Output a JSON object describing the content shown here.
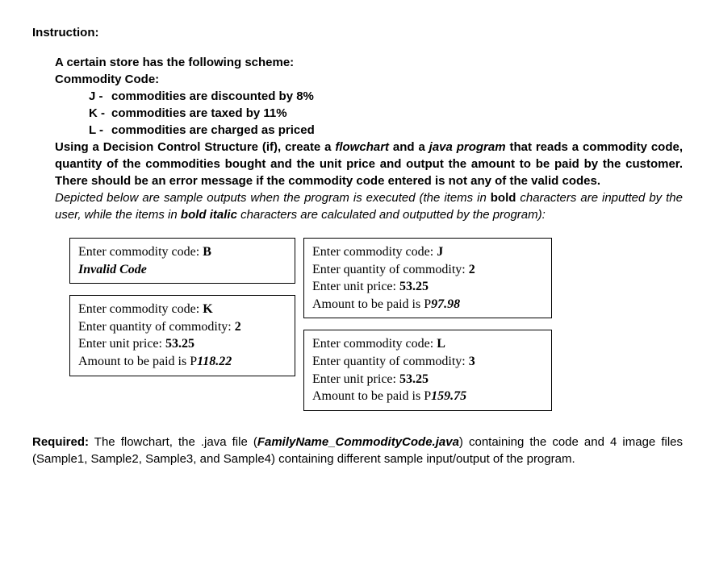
{
  "heading": "Instruction:",
  "scheme": {
    "intro1": "A certain store has the following scheme:",
    "intro2": "Commodity Code:",
    "codes": [
      {
        "letter": "J - ",
        "desc": "commodities are discounted by 8%"
      },
      {
        "letter": "K - ",
        "desc": "commodities are taxed by 11%"
      },
      {
        "letter": "L - ",
        "desc": "commodities are charged as priced"
      }
    ]
  },
  "problem": {
    "part1": "Using a Decision Control Structure (if), create a ",
    "flowchart_word": "flowchart",
    "part2": " and a ",
    "java_word": "java program",
    "part3": " that reads a commodity code, quantity of the commodities bought and the unit price and output the amount to be paid by the customer. There should be an error message if the commodity code entered is not any of the valid codes."
  },
  "depicted": {
    "part1": "Depicted below are sample outputs when the program is executed (the items in ",
    "bold_word": "bold",
    "part2": " characters are inputted by the user, while the items in ",
    "bold_italic_word": "bold italic",
    "part3": " characters are calculated and outputted by the program):"
  },
  "samples": {
    "s1": {
      "line1_prompt": "Enter commodity code: ",
      "line1_input": "B",
      "invalid": "Invalid Code"
    },
    "s2": {
      "line1_prompt": "Enter commodity code: ",
      "line1_input": "K",
      "line2_prompt": "Enter quantity of commodity: ",
      "line2_input": "2",
      "line3_prompt": "Enter unit price: ",
      "line3_input": "53.25",
      "line4_prompt": "Amount to be paid is P",
      "line4_output": "118.22"
    },
    "s3": {
      "line1_prompt": "Enter commodity code: ",
      "line1_input": "J",
      "line2_prompt": "Enter quantity of commodity: ",
      "line2_input": "2",
      "line3_prompt": "Enter unit price: ",
      "line3_input": "53.25",
      "line4_prompt": "Amount to be paid is P",
      "line4_output": "97.98"
    },
    "s4": {
      "line1_prompt": "Enter commodity code: ",
      "line1_input": "L",
      "line2_prompt": "Enter quantity of commodity: ",
      "line2_input": "3",
      "line3_prompt": "Enter unit price: ",
      "line3_input": "53.25",
      "line4_prompt": "Amount to be paid is P",
      "line4_output": "159.75"
    }
  },
  "required": {
    "label": "Required:",
    "part1": " The flowchart, the .java file (",
    "filename": "FamilyName_CommodityCode.java",
    "part2": ") containing the code and 4 image files (Sample1, Sample2, Sample3, and Sample4) containing different sample input/output of the program."
  }
}
